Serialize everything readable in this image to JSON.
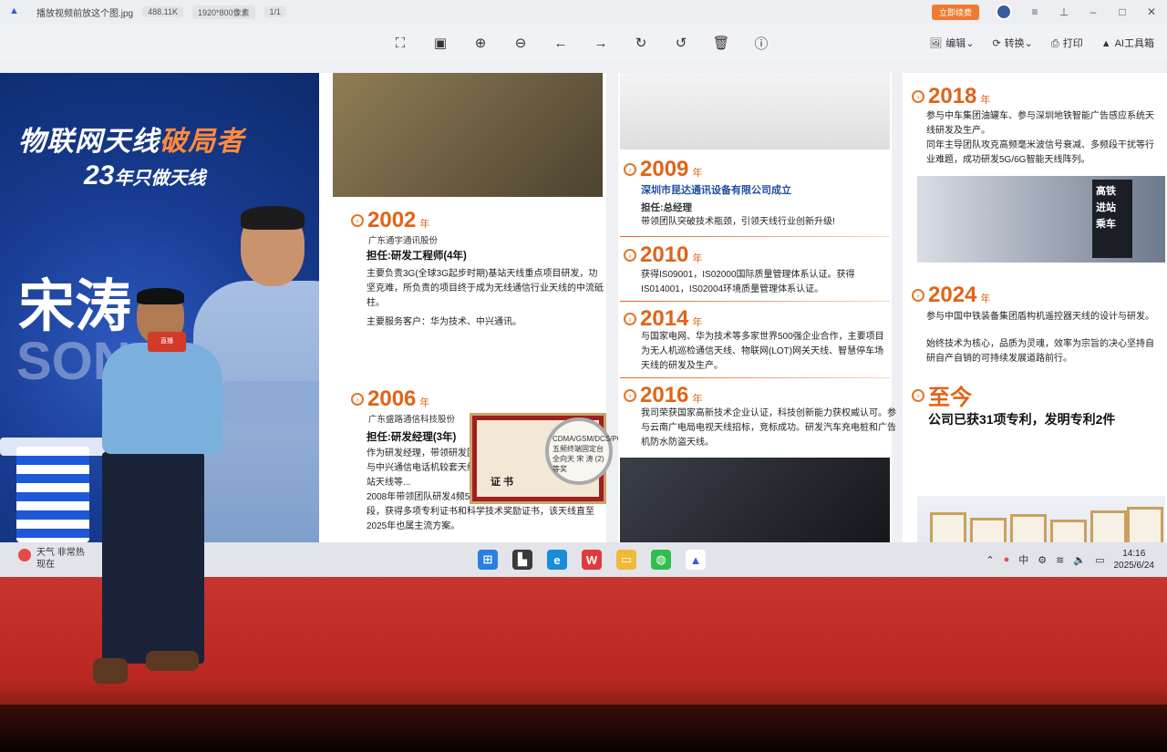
{
  "window": {
    "filename": "播放视频前放这个图.jpg",
    "filesize": "488.11K",
    "resolution": "1920*800像素",
    "page": "1/1",
    "open_button": "立即续费"
  },
  "toolbar": {
    "edit": "编辑",
    "convert": "转换",
    "print": "打印",
    "ai_tools": "AI工具箱"
  },
  "banner": {
    "title_a": "物联网天线",
    "title_b": "破局者",
    "subtitle_num": "23",
    "subtitle_rest": "年只做天线",
    "name": "宋涛",
    "name_en": "SON"
  },
  "timeline": {
    "y2002": {
      "year": "2002",
      "unit": "年",
      "company": "广东通宇通讯股份",
      "role": "担任:研发工程师(4年)",
      "desc": "主要负责3G(全球3G起步时期)基站天线重点项目研发，功坚克难，所负责的项目终于成为无线通信行业天线的中流砥柱。",
      "clients": "主要服务客户：华为技术、中兴通讯。"
    },
    "y2006": {
      "year": "2006",
      "unit": "年",
      "company": "广东盛路通信科技股份",
      "role": "担任:研发经理(3年)",
      "desc1": "作为研发经理，带领研发团队拿下多个重点项目：华为技术与中兴通信电话机较套天线（此类项目多次竞标成功）、基站天线等...",
      "desc2": "2008年带领团队研发4频5频终端天线实现1个天线覆盖多频段，获得多项专利证书和科学技术奖励证书，该天线直至2025年也属主流方案。"
    },
    "y2009": {
      "year": "2009",
      "unit": "年",
      "company": "深圳市昆达通讯设备有限公司成立",
      "role": "担任:总经理",
      "desc": "带领团队突破技术瓶颈，引领天线行业创新升级!"
    },
    "y2010": {
      "year": "2010",
      "unit": "年",
      "desc": "获得IS09001，IS02000国际质量管理体系认证。获得IS014001，IS02004环境质量管理体系认证。"
    },
    "y2014": {
      "year": "2014",
      "unit": "年",
      "desc": "与国家电网、华为技术等多家世界500强企业合作，主要项目为无人机巡检通信天线、物联网(LOT)网关天线、智慧停车场天线的研发及生产。"
    },
    "y2016": {
      "year": "2016",
      "unit": "年",
      "desc": "我司荣获国家高新技术企业认证，科技创新能力获权威认可。参与云南广电局电视天线招标，竞标成功。研发汽车充电桩和广告机防水防盗天线。"
    },
    "y2018": {
      "year": "2018",
      "unit": "年",
      "desc1": "参与中车集团油罐车、参与深圳地铁智能广告感应系统天线研发及生产。",
      "desc2": "同年主导团队攻克高频毫米波信号衰减、多频段干扰等行业难题，成功研发5G/6G智能天线阵列。"
    },
    "y2024": {
      "year": "2024",
      "unit": "年",
      "desc1": "参与中国中铁装备集团盾构机遥控器天线的设计与研发。",
      "desc2": "始终技术为核心，品质为灵魂，效率为宗旨的决心坚持自研自产自销的可持续发展道路前行。"
    },
    "now": {
      "label": "至今",
      "desc": "公司已获31项专利，发明专利2件"
    }
  },
  "certificate": {
    "label": "证 书",
    "lens_text": "CDMA/GSM/DCS/PCS 五频终端固定台全向天 宋 涛 (2) 等奖"
  },
  "sign_text": "高铁 进站 乘车",
  "taskbar": {
    "weather_title": "天气 非常热",
    "weather_sub": "现在",
    "time": "14:16",
    "date": "2025/6/24"
  },
  "speaker_mic_label": "直播"
}
